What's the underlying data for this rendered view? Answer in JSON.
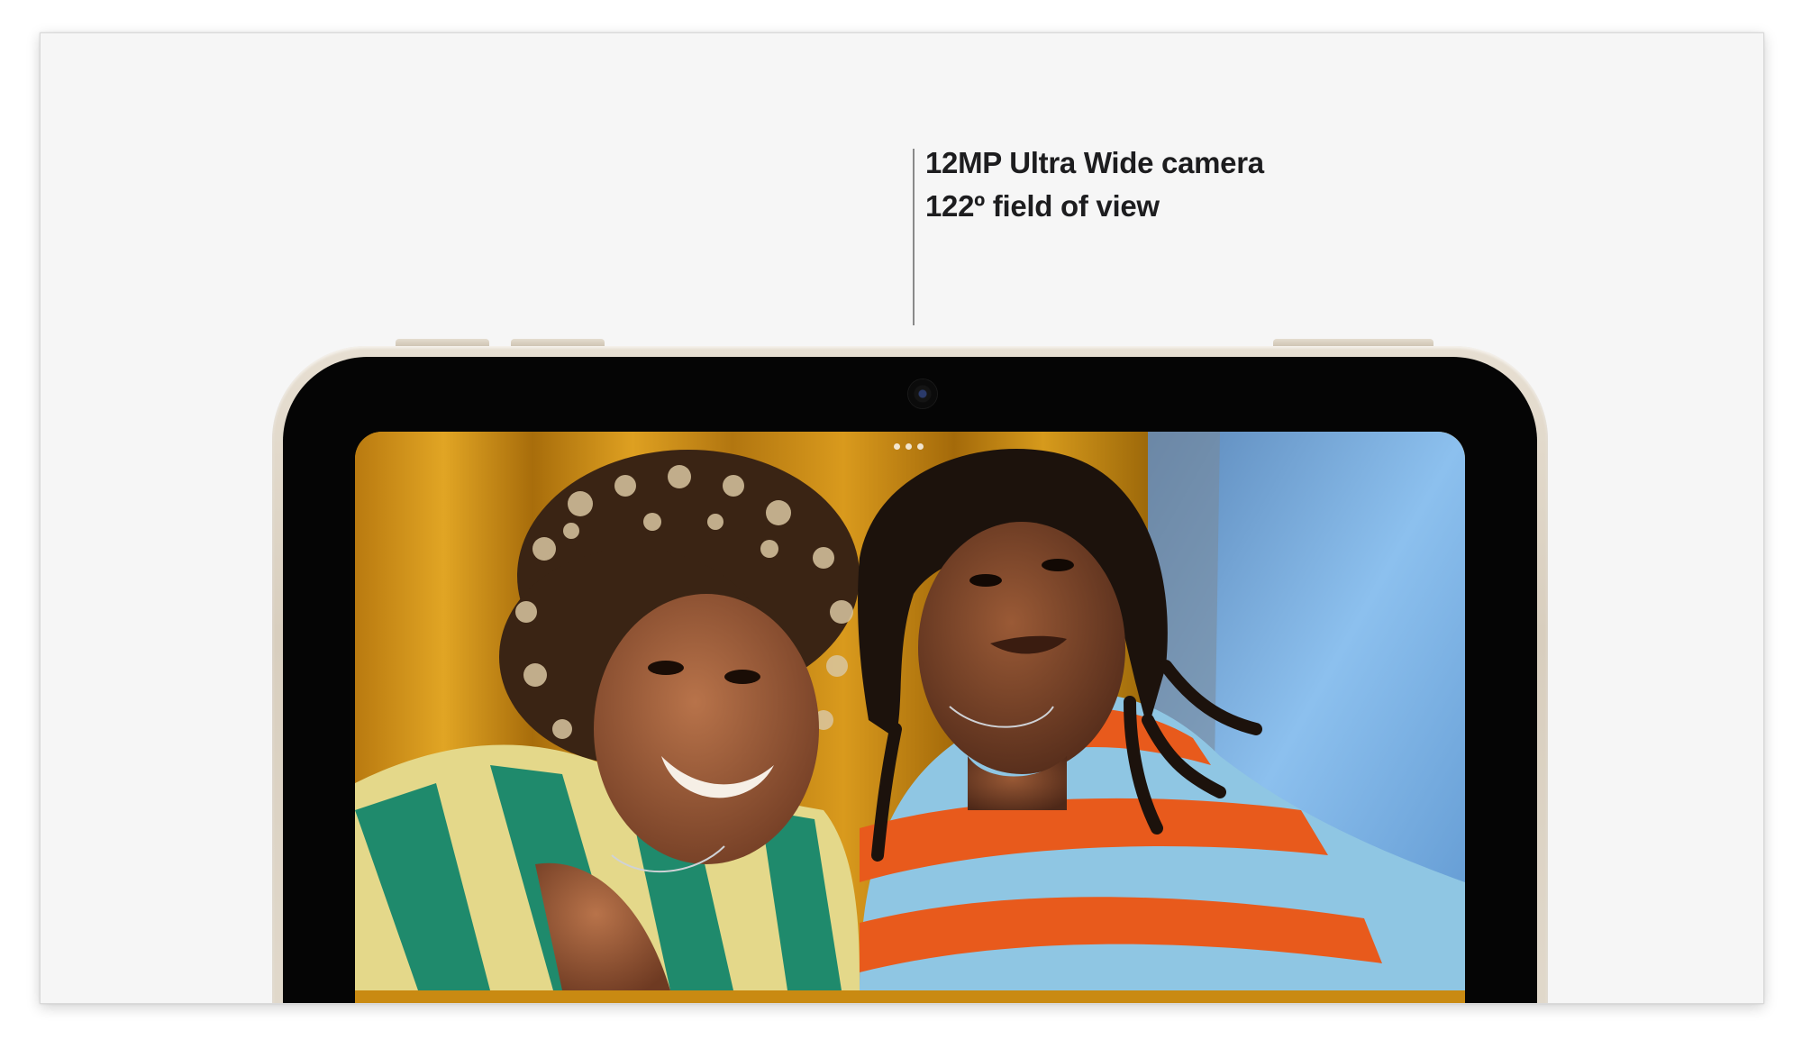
{
  "callout": {
    "line1": "12MP Ultra Wide camera",
    "line2": "122º field of view"
  },
  "colors": {
    "page_background": "#f6f6f6",
    "text": "#1d1d1f",
    "device_frame": "#e2dacd",
    "bezel": "#050505",
    "curtain": "#c98a12",
    "sky_blue": "#7fb6e6"
  },
  "screen": {
    "content": "selfie-photo",
    "subjects": [
      "person-left",
      "person-right"
    ],
    "indicator": "more-dots-icon"
  }
}
